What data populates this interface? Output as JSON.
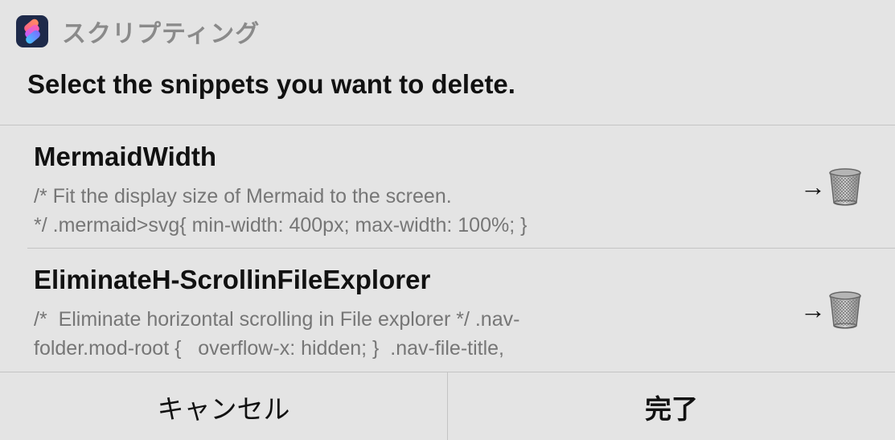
{
  "header": {
    "app_icon": "shortcuts-app-icon",
    "app_name": "スクリプティング"
  },
  "prompt": "Select the snippets you want to delete.",
  "snippets": [
    {
      "title": "MermaidWidth",
      "description": "/* Fit the display size of Mermaid to the screen.\n*/ .mermaid>svg{ min-width: 400px; max-width: 100%; }",
      "action_arrow": "→",
      "action_icon": "trash-icon"
    },
    {
      "title": "EliminateH-ScrollinFileExplorer",
      "description": "/*  Eliminate horizontal scrolling in File explorer */ .nav-\nfolder.mod-root {   overflow-x: hidden; }  .nav-file-title,",
      "action_arrow": "→",
      "action_icon": "trash-icon"
    }
  ],
  "buttons": {
    "cancel": "キャンセル",
    "done": "完了"
  },
  "colors": {
    "background": "#e4e4e4",
    "divider": "#c4c4c4",
    "secondary_text": "#767676",
    "header_text": "#8a8a8a"
  }
}
